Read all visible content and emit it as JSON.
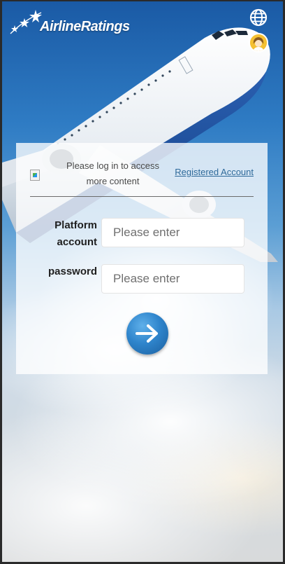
{
  "header": {
    "brand": "AirlineRatings",
    "language_icon": "globe-icon",
    "avatar_icon": "user-avatar-icon"
  },
  "login_panel": {
    "hint": "Please log in to access more content",
    "register_link": "Registered Account",
    "account_label": "Platform account",
    "account_placeholder": "Please enter",
    "account_value": "",
    "password_label": "password",
    "password_placeholder": "Please enter",
    "password_value": "",
    "submit_icon": "arrow-right-icon"
  },
  "colors": {
    "accent": "#2f85cc",
    "link": "#2f6a9a",
    "avatar_bg": "#f4c032"
  }
}
